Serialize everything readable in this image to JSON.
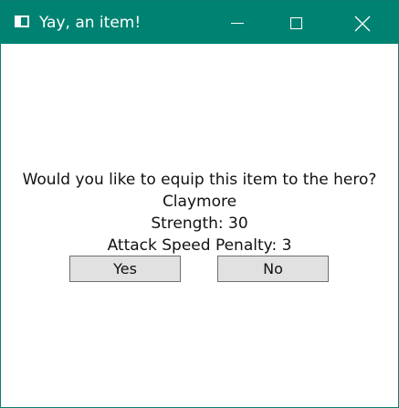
{
  "window": {
    "title": "Yay, an item!",
    "icons": {
      "app": "window-icon",
      "minimize": "minimize-icon",
      "maximize": "maximize-icon",
      "close": "close-icon"
    },
    "colors": {
      "titlebar": "#008272",
      "button_face": "#e1e1e1",
      "button_border": "#6f6f6f"
    }
  },
  "dialog": {
    "question": "Would you like to equip this item to the hero?",
    "item_name": "Claymore",
    "strength": "Strength: 30",
    "attack_speed_penalty": "Attack Speed Penalty: 3",
    "yes_label": "Yes",
    "no_label": "No"
  }
}
